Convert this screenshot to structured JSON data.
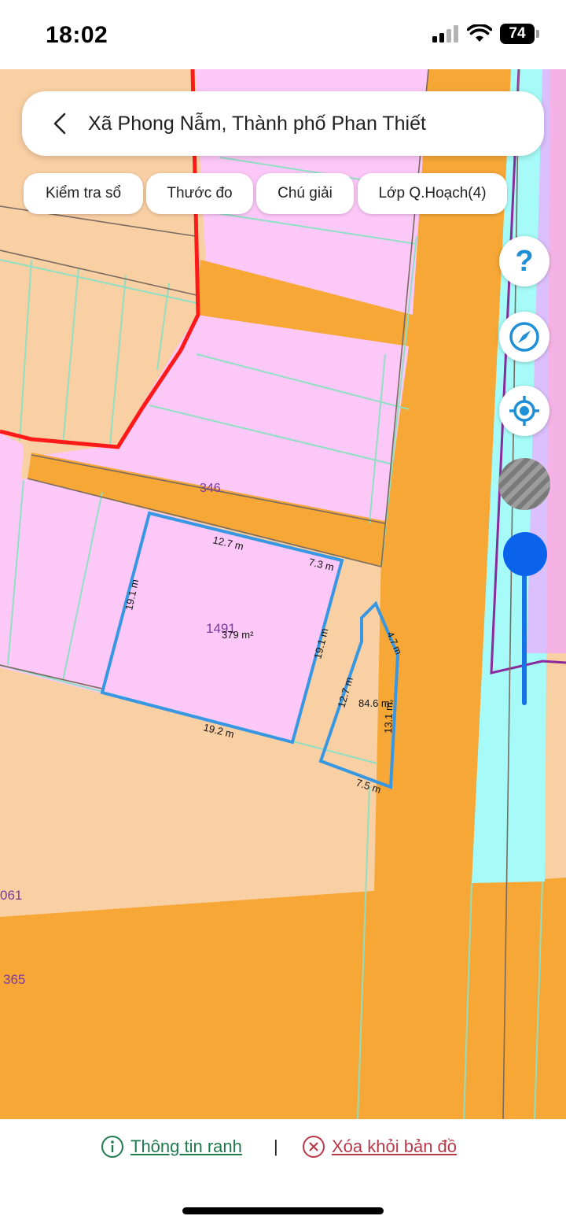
{
  "status_bar": {
    "time": "18:02",
    "battery": "74"
  },
  "search": {
    "title": "Xã Phong Nẫm, Thành phố Phan Thiết"
  },
  "chips": [
    {
      "label": "Kiểm tra sổ"
    },
    {
      "label": "Thước đo"
    },
    {
      "label": "Chú giải"
    },
    {
      "label": "Lớp Q.Hoạch(4)"
    }
  ],
  "controls": {
    "help_label": "?"
  },
  "map": {
    "colors": {
      "residential_light": "#f9cfa4",
      "commercial_pink": "#fcc8f8",
      "road_orange": "#f6a736",
      "water_cyan": "#a6fbf8",
      "boundary_red": "#ff1a1a",
      "selection_blue": "#3897e3",
      "planning_purple": "#8a2a9c"
    },
    "labels": {
      "road_number": "346",
      "parcel_number": "1491",
      "area_main": "379 m²",
      "area_small": "84.6 m²",
      "left_label_1": "061",
      "left_label_2": "365"
    },
    "dimensions": {
      "top": "12.7 m",
      "top_right": "7.3 m",
      "left": "19.1 m",
      "right": "19.1 m",
      "bottom": "19.2 m",
      "small_left": "12.7 m",
      "small_top": "4.7 m",
      "small_right": "13.1 m",
      "small_bottom": "7.5 m"
    }
  },
  "bottom_bar": {
    "info_label": "Thông tin ranh",
    "separator": "|",
    "clear_label": "Xóa khỏi bản đồ"
  }
}
